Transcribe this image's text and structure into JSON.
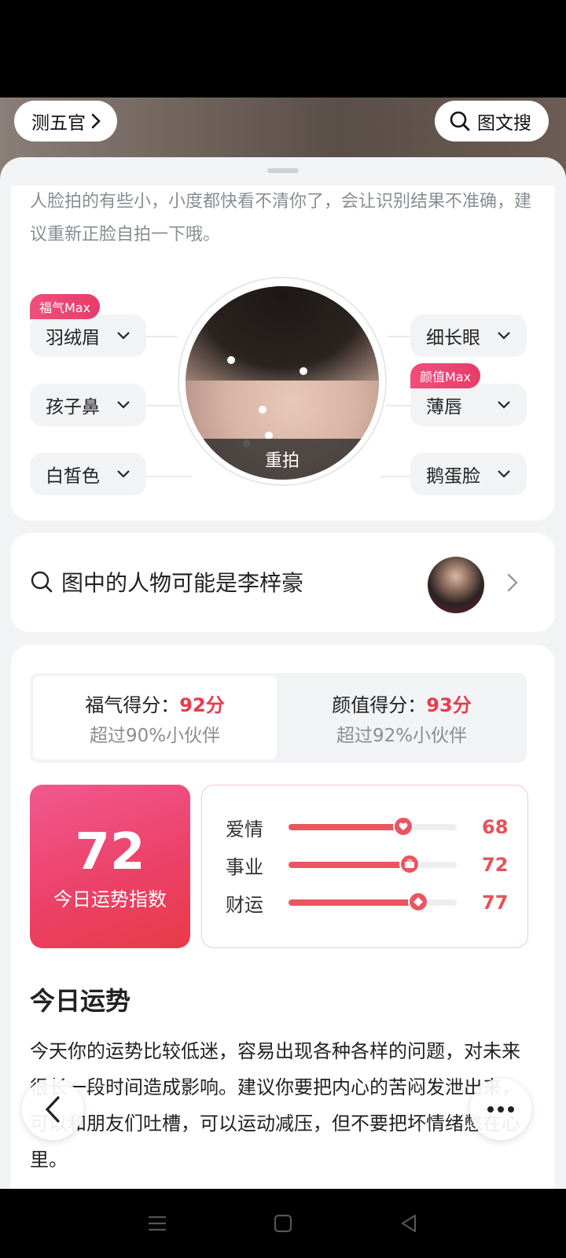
{
  "header": {
    "left_pill_label": "测五官",
    "right_pill_label": "图文搜"
  },
  "face_analysis": {
    "warning": "人脸拍的有些小，小度都快看不清你了，会让识别结果不准确，建议重新正脸自拍一下哦。",
    "features_left": [
      {
        "label": "羽绒眉",
        "tag": "福气Max"
      },
      {
        "label": "孩子鼻",
        "tag": ""
      },
      {
        "label": "白皙色",
        "tag": ""
      }
    ],
    "features_right": [
      {
        "label": "细长眼",
        "tag": ""
      },
      {
        "label": "薄唇",
        "tag": "颜值Max"
      },
      {
        "label": "鹅蛋脸",
        "tag": ""
      }
    ],
    "retake_label": "重拍"
  },
  "person_search": {
    "text": "图中的人物可能是李梓豪"
  },
  "scores": {
    "fortune_label": "福气得分：",
    "fortune_value": "92分",
    "fortune_sub": "超过90%小伙伴",
    "beauty_label": "颜值得分：",
    "beauty_value": "93分",
    "beauty_sub": "超过92%小伙伴"
  },
  "daily": {
    "index_value": "72",
    "index_label": "今日运势指数",
    "bars": [
      {
        "name": "爱情",
        "value": 68,
        "icon": "heart-icon"
      },
      {
        "name": "事业",
        "value": 72,
        "icon": "briefcase-icon"
      },
      {
        "name": "财运",
        "value": 77,
        "icon": "diamond-icon"
      }
    ],
    "title": "今日运势",
    "text": "今天你的运势比较低迷，容易出现各种各样的问题，对未来很长一段时间造成影响。建议你要把内心的苦闷发泄出来，可以和朋友们吐槽，可以运动减压，但不要把坏情绪憋在心里。"
  },
  "colors": {
    "accent_red": "#e83c4c",
    "tag_pink": "#f04e7c",
    "bar_red": "#eb5560"
  }
}
